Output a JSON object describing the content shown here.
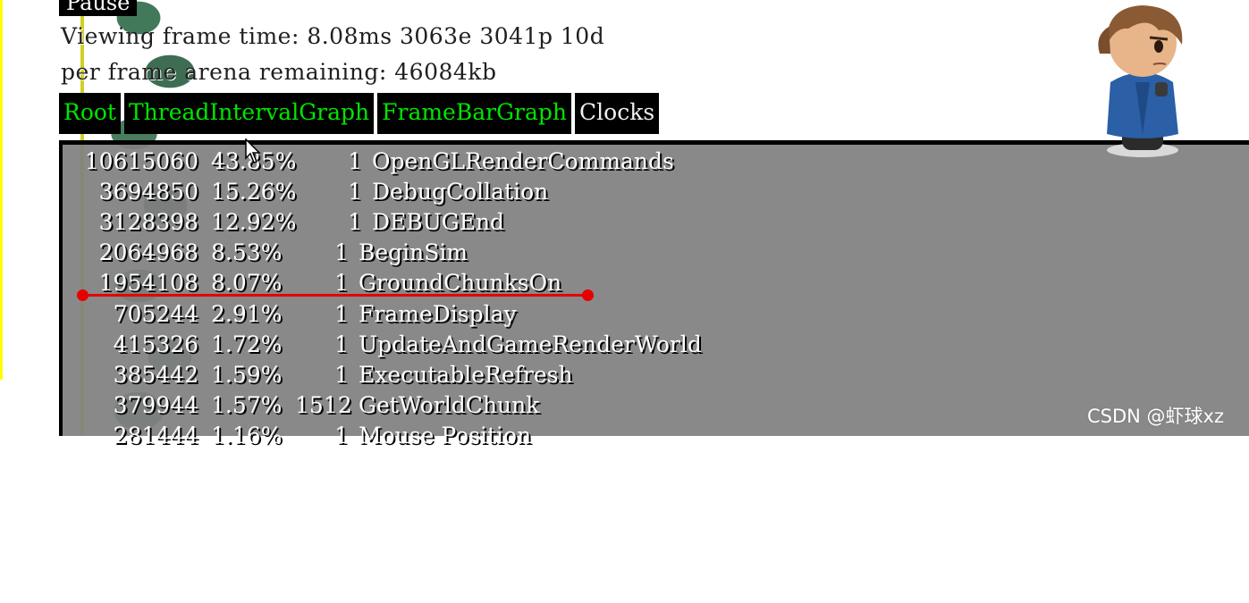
{
  "top_button": {
    "label": "Pause"
  },
  "stats": {
    "frame_line": "Viewing frame time: 8.08ms 3063e 3041p 10d",
    "arena_line": "per frame arena remaining: 46084kb"
  },
  "tabs": [
    {
      "label": "Root"
    },
    {
      "label": "ThreadIntervalGraph"
    },
    {
      "label": "FrameBarGraph"
    },
    {
      "label": "Clocks"
    }
  ],
  "profile": {
    "rows": [
      {
        "cycles": "10615060",
        "percent": "43.85%",
        "count": "1",
        "name": "OpenGLRenderCommands"
      },
      {
        "cycles": "3694850",
        "percent": "15.26%",
        "count": "1",
        "name": "DebugCollation"
      },
      {
        "cycles": "3128398",
        "percent": "12.92%",
        "count": "1",
        "name": "DEBUGEnd"
      },
      {
        "cycles": "2064968",
        "percent": "8.53%",
        "count": "1",
        "name": "BeginSim"
      },
      {
        "cycles": "1954108",
        "percent": "8.07%",
        "count": "1",
        "name": "GroundChunksOn"
      },
      {
        "cycles": "705244",
        "percent": "2.91%",
        "count": "1",
        "name": "FrameDisplay"
      },
      {
        "cycles": "415326",
        "percent": "1.72%",
        "count": "1",
        "name": "UpdateAndGameRenderWorld"
      },
      {
        "cycles": "385442",
        "percent": "1.59%",
        "count": "1",
        "name": "ExecutableRefresh"
      },
      {
        "cycles": "379944",
        "percent": "1.57%",
        "count": "1512",
        "name": "GetWorldChunk"
      },
      {
        "cycles": "281444",
        "percent": "1.16%",
        "count": "1",
        "name": "Mouse Position"
      }
    ]
  },
  "watermark": "CSDN @虾球xz",
  "colors": {
    "tab_active_text": "#00e600",
    "panel_bg": "#808080",
    "annotation_red": "#e60000"
  }
}
